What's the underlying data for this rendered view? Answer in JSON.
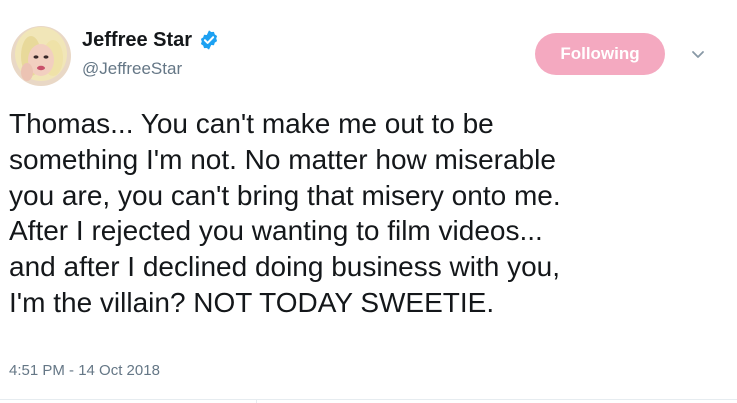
{
  "tweet": {
    "author": {
      "display_name": "Jeffree Star",
      "handle": "@JeffreeStar",
      "verified": true,
      "avatar_icon": "profile-avatar"
    },
    "follow_button": {
      "label": "Following",
      "color": "#f4a9c0"
    },
    "caret_icon": "chevron-down-icon",
    "text": "Thomas... You can't make me out to be\nsomething I'm not. No matter how miserable\nyou are, you can't bring that misery onto me.\nAfter I rejected you wanting to film videos...\nand after I declined doing business with you,\nI'm the villain? NOT TODAY SWEETIE.",
    "timestamp": "4:51 PM - 14 Oct 2018"
  },
  "colors": {
    "verified_blue": "#1da1f2",
    "secondary_text": "#657786",
    "primary_text": "#14171a"
  }
}
